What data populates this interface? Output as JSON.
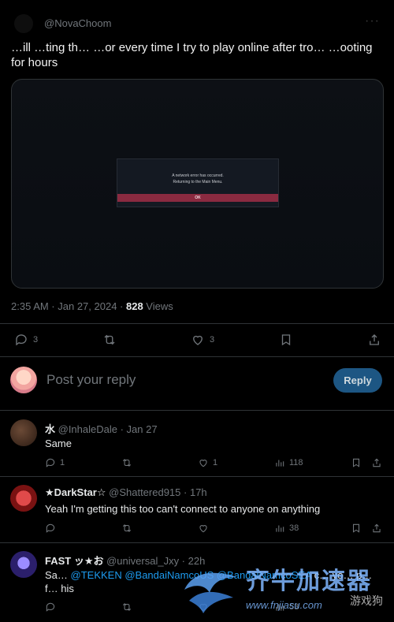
{
  "tweet": {
    "handle": "@NovaChoom",
    "text": "…ill …ting th… …or every time I try to play online after tro… …ooting for hours",
    "media": {
      "dialog_line1": "A network error has occurred.",
      "dialog_line2": "Returning to the Main Menu.",
      "dialog_ok": "OK"
    },
    "time": "2:35 AM · Jan 27, 2024 · ",
    "views_count": "828",
    "views_label": " Views",
    "actions": {
      "replies": "3",
      "likes": "3"
    }
  },
  "composer": {
    "placeholder": "Post your reply",
    "button": "Reply"
  },
  "replies": [
    {
      "name": "水",
      "meta": " @InhaleDale · Jan 27",
      "text": "Same",
      "replies": "1",
      "likes": "1",
      "views": "118"
    },
    {
      "name": "★DarkStar☆",
      "meta": " @Shattered915 · 17h",
      "text": "Yeah I'm getting this too can't connect to anyone on anything",
      "replies": "",
      "likes": "",
      "views": "38"
    },
    {
      "name": "FAST ッ★お",
      "meta": " @universal_Jxy · 22h",
      "text_pre": "Sa… ",
      "mentions": "@TEKKEN @BandaiNamcoUS @BandaiNamcoSEA",
      "text_post": " c…  yo…  p…  f…  his",
      "views": "53"
    }
  ],
  "watermark": {
    "brand": "齐牛加速器",
    "url": "www.fnjiasu.com",
    "sub": "游戏狗"
  },
  "colors": {
    "accent": "#1d9bf0",
    "reply_button": "#1d5683",
    "dialog_ok": "#8a2a40",
    "divider": "#2f3336"
  }
}
